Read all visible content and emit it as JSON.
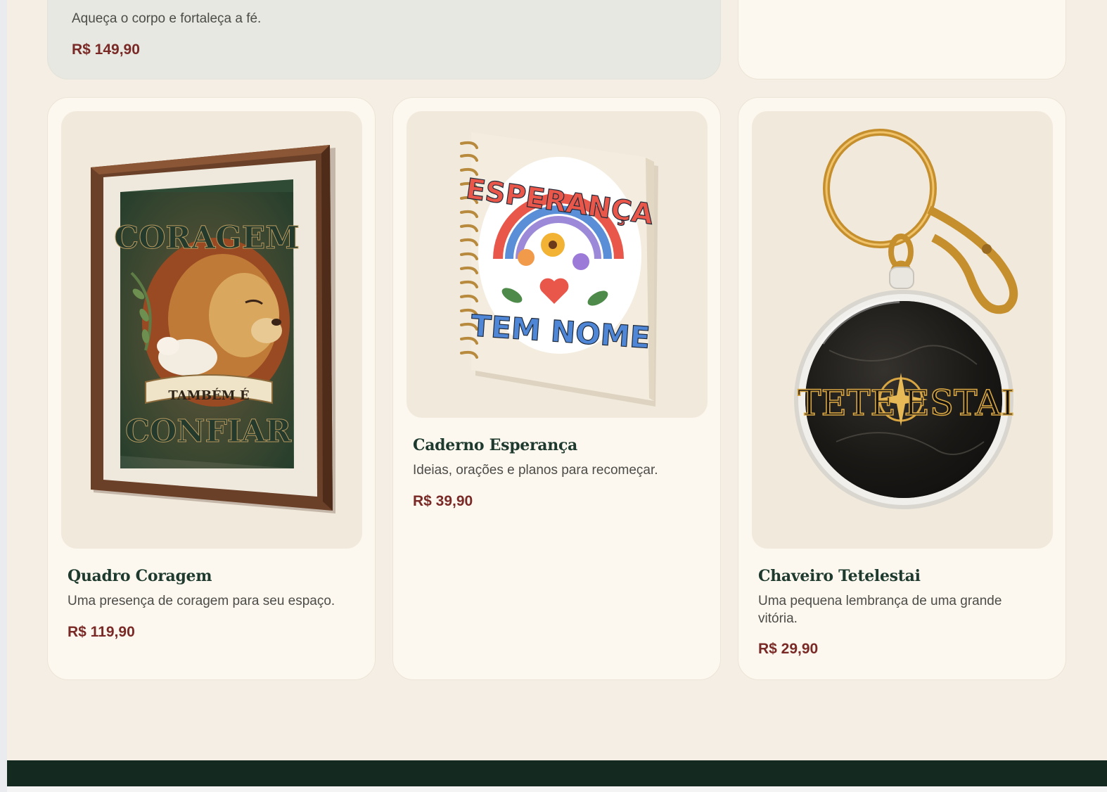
{
  "products": [
    {
      "description": "Aqueça o corpo e fortaleça a fé.",
      "price": "R$ 149,90"
    },
    {
      "title": "Quadro Coragem",
      "description": "Uma presença de coragem para seu espaço.",
      "price": "R$ 119,90",
      "image_text": [
        "CORAGEM",
        "TAMBÉM É",
        "CONFIAR"
      ]
    },
    {
      "title": "Caderno Esperança",
      "description": "Ideias, orações e planos para recomeçar.",
      "price": "R$ 39,90",
      "image_text": [
        "ESPERANÇA",
        "TEM NOME"
      ]
    },
    {
      "title": "Chaveiro Tetelestai",
      "description": "Uma pequena lembrança de uma grande vitória.",
      "price": "R$ 29,90",
      "image_text": [
        "TETE",
        "ESTAI"
      ]
    }
  ],
  "colors": {
    "page_background": "#f4eee4",
    "card_background": "#fdf8ef",
    "featured_card_background": "#e7e8e1",
    "title": "#1e3a2e",
    "price": "#7a2a26",
    "footer": "#142a21"
  },
  "icons": [
    "framed-lion-print-image",
    "spiral-notebook-image",
    "keychain-image"
  ]
}
